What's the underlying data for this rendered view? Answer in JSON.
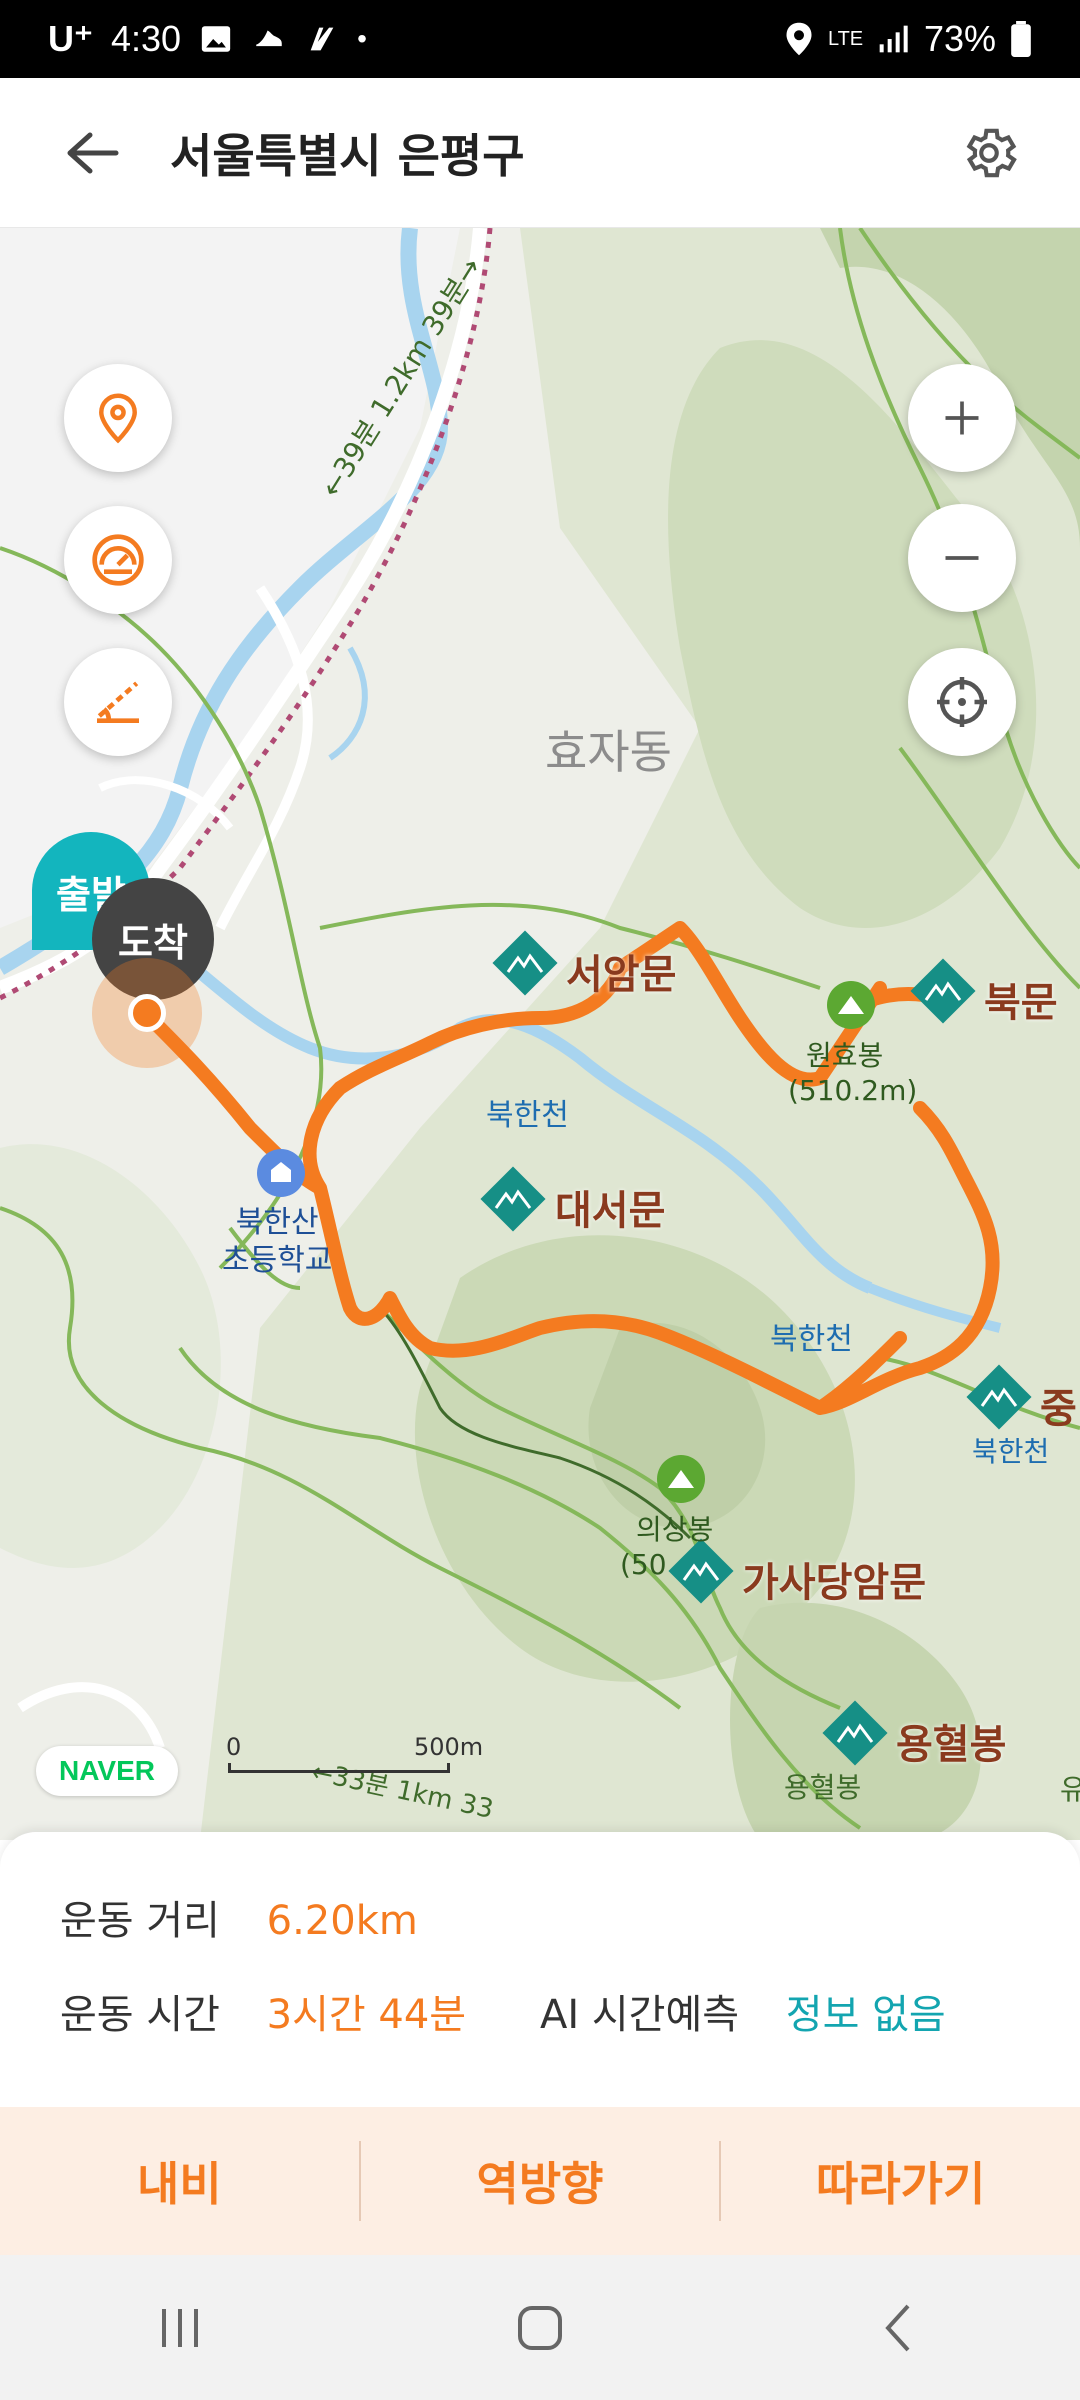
{
  "status_bar": {
    "carrier": "U⁺",
    "time": "4:30",
    "battery": "73%",
    "network": "LTE"
  },
  "header": {
    "title": "서울특별시 은평구"
  },
  "map": {
    "area_label": "효자동",
    "trail_label": "←39분 1.2km 39분→",
    "trail_label_bottom": "←33분 1km 33",
    "start_badge": "출발",
    "end_badge": "도착",
    "places": {
      "seoammun": "서암문",
      "bukmun": "북문",
      "daeseomun": "대서문",
      "gasadang": "가사당암문",
      "yonghyeol": "용혈봉",
      "yonghyeol_peak": "용혈봉",
      "jung": "중",
      "jung_sub": "북한천",
      "wonhyobong": "원효봉",
      "wonhyobong_alt": "(510.2m)",
      "uisangbong": "의상봉",
      "uisangbong_alt": "(50",
      "bukhancheon1": "북한천",
      "bukhancheon2": "북한천",
      "school": "북한산\n초등학교",
      "far_right": "유"
    },
    "scale": {
      "start": "0",
      "end": "500m"
    },
    "brand": "NAVER"
  },
  "summary": {
    "distance_label": "운동 거리",
    "distance_value": "6.20km",
    "time_label": "운동 시간",
    "time_value": "3시간 44분",
    "ai_label": "AI 시간예측",
    "ai_value": "정보 없음"
  },
  "actions": {
    "navi": "내비",
    "reverse": "역방향",
    "follow": "따라가기"
  },
  "colors": {
    "accent": "#f47b20",
    "teal": "#13a5b0",
    "route": "#f47b20"
  }
}
